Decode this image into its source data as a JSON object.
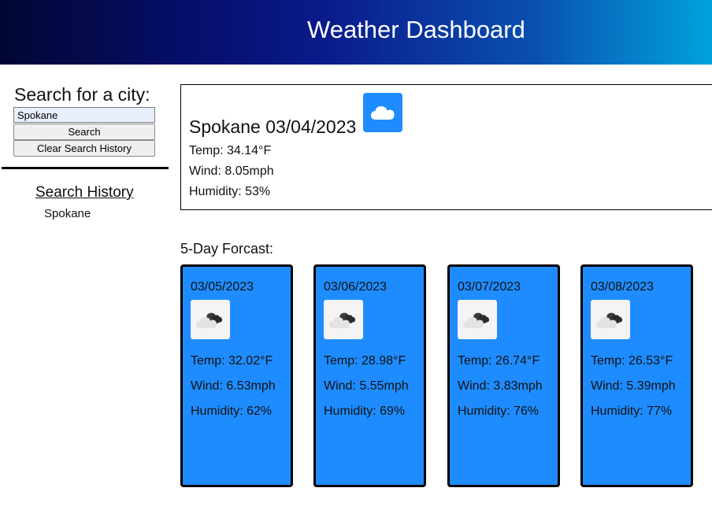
{
  "header": {
    "title": "Weather Dashboard"
  },
  "sidebar": {
    "search_label": "Search for a city:",
    "city_input_value": "Spokane",
    "search_button": "Search",
    "clear_button": "Clear Search History",
    "history_title": "Search History",
    "history": [
      "Spokane"
    ]
  },
  "current": {
    "title": "Spokane 03/04/2023",
    "icon": "cloud-icon",
    "temp": "Temp: 34.14°F",
    "wind": "Wind: 8.05mph",
    "humidity": "Humidity: 53%"
  },
  "forecast": {
    "title": "5-Day Forcast:",
    "days": [
      {
        "date": "03/05/2023",
        "icon": "overcast-cloud-icon",
        "temp": "Temp: 32.02°F",
        "wind": "Wind: 6.53mph",
        "humidity": "Humidity: 62%"
      },
      {
        "date": "03/06/2023",
        "icon": "overcast-cloud-icon",
        "temp": "Temp: 28.98°F",
        "wind": "Wind: 5.55mph",
        "humidity": "Humidity: 69%"
      },
      {
        "date": "03/07/2023",
        "icon": "overcast-cloud-icon",
        "temp": "Temp: 26.74°F",
        "wind": "Wind: 3.83mph",
        "humidity": "Humidity: 76%"
      },
      {
        "date": "03/08/2023",
        "icon": "overcast-cloud-icon",
        "temp": "Temp: 26.53°F",
        "wind": "Wind: 5.39mph",
        "humidity": "Humidity: 77%"
      }
    ]
  },
  "colors": {
    "card_background": "#1e8cff",
    "header_gradient_start": "#020633",
    "header_gradient_end": "#00a2dc"
  }
}
